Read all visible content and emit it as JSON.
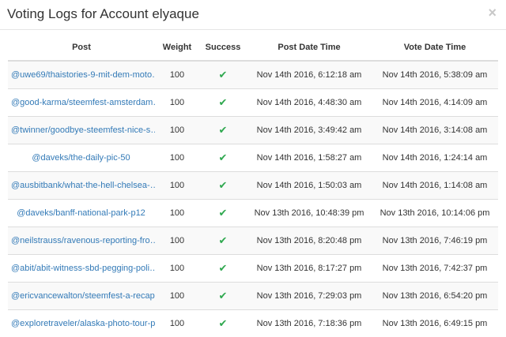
{
  "modal": {
    "title": "Voting Logs for Account elyaque",
    "close_glyph": "×"
  },
  "table": {
    "headers": {
      "post": "Post",
      "weight": "Weight",
      "success": "Success",
      "post_date": "Post Date Time",
      "vote_date": "Vote Date Time"
    },
    "success_icon": "check-icon",
    "success_color": "#2fa84f",
    "link_color": "#337ab7",
    "rows": [
      {
        "post": "@uwe69/thaistories-9-mit-dem-moto…",
        "weight": "100",
        "success": "✔",
        "post_date": "Nov 14th 2016, 6:12:18 am",
        "vote_date": "Nov 14th 2016, 5:38:09 am"
      },
      {
        "post": "@good-karma/steemfest-amsterdam…",
        "weight": "100",
        "success": "✔",
        "post_date": "Nov 14th 2016, 4:48:30 am",
        "vote_date": "Nov 14th 2016, 4:14:09 am"
      },
      {
        "post": "@twinner/goodbye-steemfest-nice-s…",
        "weight": "100",
        "success": "✔",
        "post_date": "Nov 14th 2016, 3:49:42 am",
        "vote_date": "Nov 14th 2016, 3:14:08 am"
      },
      {
        "post": "@daveks/the-daily-pic-50",
        "weight": "100",
        "success": "✔",
        "post_date": "Nov 14th 2016, 1:58:27 am",
        "vote_date": "Nov 14th 2016, 1:24:14 am"
      },
      {
        "post": "@ausbitbank/what-the-hell-chelsea-…",
        "weight": "100",
        "success": "✔",
        "post_date": "Nov 14th 2016, 1:50:03 am",
        "vote_date": "Nov 14th 2016, 1:14:08 am"
      },
      {
        "post": "@daveks/banff-national-park-p12",
        "weight": "100",
        "success": "✔",
        "post_date": "Nov 13th 2016, 10:48:39 pm",
        "vote_date": "Nov 13th 2016, 10:14:06 pm"
      },
      {
        "post": "@neilstrauss/ravenous-reporting-fro…",
        "weight": "100",
        "success": "✔",
        "post_date": "Nov 13th 2016, 8:20:48 pm",
        "vote_date": "Nov 13th 2016, 7:46:19 pm"
      },
      {
        "post": "@abit/abit-witness-sbd-pegging-poli…",
        "weight": "100",
        "success": "✔",
        "post_date": "Nov 13th 2016, 8:17:27 pm",
        "vote_date": "Nov 13th 2016, 7:42:37 pm"
      },
      {
        "post": "@ericvancewalton/steemfest-a-recap…",
        "weight": "100",
        "success": "✔",
        "post_date": "Nov 13th 2016, 7:29:03 pm",
        "vote_date": "Nov 13th 2016, 6:54:20 pm"
      },
      {
        "post": "@exploretraveler/alaska-photo-tour-p…",
        "weight": "100",
        "success": "✔",
        "post_date": "Nov 13th 2016, 7:18:36 pm",
        "vote_date": "Nov 13th 2016, 6:49:15 pm"
      }
    ]
  }
}
